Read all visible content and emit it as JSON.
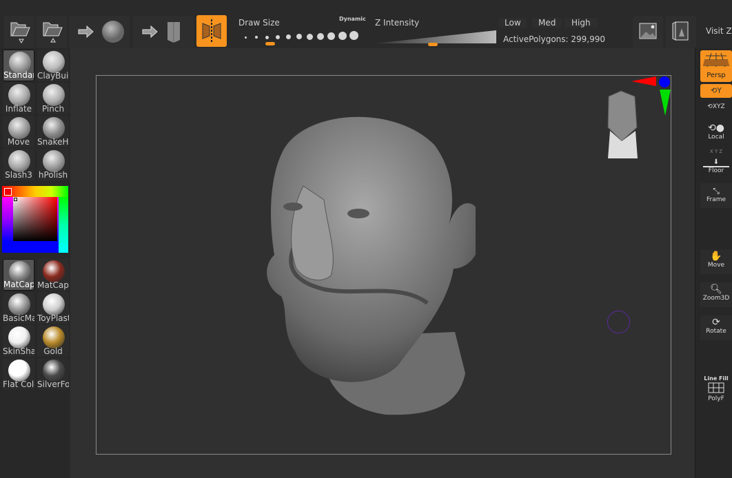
{
  "colors": {
    "accent": "#f7931e",
    "background": "#303030",
    "panel": "#282828"
  },
  "toolbar": {
    "open_icon": "folder-open-down-icon",
    "save_icon": "folder-save-up-icon",
    "draw_size_label": "Draw Size",
    "dynamic_label": "Dynamic",
    "draw_size_level": 3,
    "z_intensity_label": "Z Intensity",
    "z_intensity_fraction": 0.47,
    "low_label": "Low",
    "med_label": "Med",
    "high_label": "High",
    "active_polygons": "ActivePolygons: 299,990",
    "visit_label": "Visit ZE"
  },
  "brushes": [
    {
      "label": "Standard",
      "selected": true
    },
    {
      "label": "ClayBuil"
    },
    {
      "label": "Inflate"
    },
    {
      "label": "Pinch"
    },
    {
      "label": "Move"
    },
    {
      "label": "SnakeHo"
    },
    {
      "label": "Slash3"
    },
    {
      "label": "hPolish"
    }
  ],
  "materials": [
    {
      "label": "MatCap",
      "selected": true,
      "color": "#8a8a8a"
    },
    {
      "label": "MatCap",
      "color": "#8a2a1e"
    },
    {
      "label": "BasicMa",
      "color": "#9a9a9a"
    },
    {
      "label": "ToyPlast",
      "color": "#cfcfcf"
    },
    {
      "label": "SkinSha",
      "color": "#f0f0f0"
    },
    {
      "label": "Gold",
      "color": "#b88a2a"
    },
    {
      "label": "Flat Colc",
      "color": "#ffffff"
    },
    {
      "label": "SilverFo",
      "color": "#4a4a4a"
    }
  ],
  "right": {
    "persp": "Persp",
    "y_axis": "Y",
    "xyz": "XYZ",
    "local": "Local",
    "axes": "X Y Z",
    "floor": "Floor",
    "frame": "Frame",
    "move": "Move",
    "zoom3d": "Zoom3D",
    "rotate": "Rotate",
    "line_fill": "Line Fill",
    "polyf": "PolyF"
  }
}
